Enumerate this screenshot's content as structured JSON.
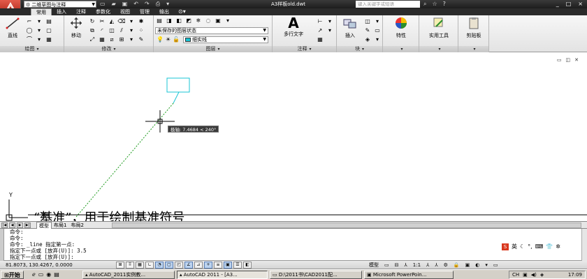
{
  "titlebar": {
    "workspace": "二维草图与注释",
    "qat_icons": [
      "new-icon",
      "open-icon",
      "save-icon",
      "undo-icon",
      "redo-icon",
      "plot-icon"
    ],
    "document_title": "A3样板old.dwt",
    "help_search_placeholder": "键入关键字或短语",
    "window_buttons": [
      "_",
      "□",
      "×"
    ]
  },
  "tabs": [
    {
      "label": "常用",
      "active": true
    },
    {
      "label": "插入",
      "active": false
    },
    {
      "label": "注释",
      "active": false
    },
    {
      "label": "参数化",
      "active": false
    },
    {
      "label": "视图",
      "active": false
    },
    {
      "label": "管理",
      "active": false
    },
    {
      "label": "输出",
      "active": false
    }
  ],
  "ribbon": {
    "draw": {
      "title": "绘图",
      "line_label": "直线"
    },
    "modify": {
      "title": "修改",
      "move_label": "移动"
    },
    "layers": {
      "title": "图层",
      "layer_state": "未保存的图层状态",
      "current_layer": "细实线"
    },
    "annotation": {
      "title": "注释",
      "mtext_label": "多行文字"
    },
    "block": {
      "title": "块",
      "insert_label": "插入"
    },
    "properties": {
      "label": "特性"
    },
    "utilities": {
      "label": "实用工具"
    },
    "clipboard": {
      "label": "剪贴板"
    }
  },
  "drawing": {
    "polar_tooltip": "极轴: 7.4684 < 240°",
    "ucs_y_label": "Y",
    "bottom_text": "“基准”，用于绘制基准符号"
  },
  "layout_tabs": [
    {
      "label": "模型",
      "active": true
    },
    {
      "label": "布局1",
      "active": false
    },
    {
      "label": "布局2",
      "active": false
    }
  ],
  "command_lines": [
    "命令:",
    "命令:",
    "命令: _line 指定第一点:",
    "指定下一点或 [放弃(U)]: 3.5",
    "指定下一点或 [放弃(U)]:"
  ],
  "ime": {
    "mode": "英"
  },
  "statusbar": {
    "coordinates": "81.8073, 130.4267, 0.0000",
    "model_label": "模型",
    "scale": "1:1"
  },
  "taskbar": {
    "start_label": "开始",
    "buttons": [
      {
        "label": "AutoCAD_2011实例教...",
        "active": false
      },
      {
        "label": "AutoCAD 2011 - [A3...",
        "active": true
      },
      {
        "label": "D:\\2011书\\CAD2011配...",
        "active": false
      },
      {
        "label": "Microsoft PowerPoin...",
        "active": false
      }
    ],
    "clock": "17:09"
  },
  "colors": {
    "title_bg": "#2b2b2b",
    "dimension_cyan": "#19c4d4",
    "tracking_green": "#1a9a1a",
    "crosshair": "#000000"
  }
}
